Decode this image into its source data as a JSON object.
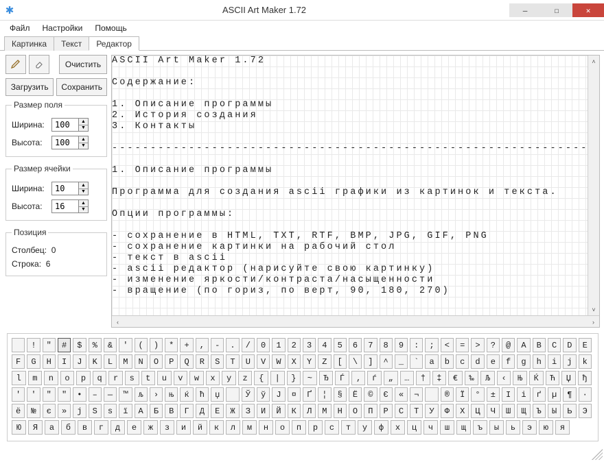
{
  "window": {
    "title": "ASCII Art Maker 1.72"
  },
  "menu": {
    "file": "Файл",
    "settings": "Настройки",
    "help": "Помощь"
  },
  "tabs": {
    "picture": "Картинка",
    "text": "Текст",
    "editor": "Редактор"
  },
  "tools": {
    "pencil_icon": "pencil-icon",
    "eraser_icon": "eraser-icon",
    "clear": "Очистить",
    "load": "Загрузить",
    "save": "Сохранить"
  },
  "field_size": {
    "legend": "Размер поля",
    "width_label": "Ширина:",
    "width_value": "100",
    "height_label": "Высота:",
    "height_value": "100"
  },
  "cell_size": {
    "legend": "Размер ячейки",
    "width_label": "Ширина:",
    "width_value": "10",
    "height_label": "Высота:",
    "height_value": "16"
  },
  "position": {
    "legend": "Позиция",
    "col_label": "Столбец:",
    "col_value": "0",
    "row_label": "Строка:",
    "row_value": "6"
  },
  "editor_text": "ASCII Art Maker 1.72\n\nСодержание:\n\n1. Описание программы\n2. История создания\n3. Контакты\n\n------------------------------------------------------------------\n\n1. Описание программы\n\nПрограмма для создания ascii графики из картинок и текста.\n\nОпции программы:\n\n- сохранение в HTML, TXT, RTF, BMP, JPG, GIF, PNG\n- сохранение картинки на рабочий стол\n- текст в ascii\n- ascii редактор (нарисуйте свою картинку)\n- изменение яркости/контраста/насыщенности\n- вращение (по гориз, по верт, 90, 180, 270)",
  "palette": [
    [
      " ",
      "!",
      "\"",
      "#",
      "$",
      "%",
      "&",
      "'",
      "(",
      ")",
      "*",
      "+",
      ",",
      "-",
      ".",
      "/",
      "0",
      "1",
      "2",
      "3",
      "4",
      "5",
      "6",
      "7",
      "8",
      "9",
      ":",
      ";",
      "<",
      "=",
      ">",
      "?",
      "@",
      "A",
      "B",
      "C",
      "D",
      "E"
    ],
    [
      "F",
      "G",
      "H",
      "I",
      "J",
      "K",
      "L",
      "M",
      "N",
      "O",
      "P",
      "Q",
      "R",
      "S",
      "T",
      "U",
      "V",
      "W",
      "X",
      "Y",
      "Z",
      "[",
      "\\",
      "]",
      "^",
      "_",
      "`",
      "a",
      "b",
      "c",
      "d",
      "e",
      "f",
      "g",
      "h",
      "i",
      "j",
      "k"
    ],
    [
      "l",
      "m",
      "n",
      "o",
      "p",
      "q",
      "r",
      "s",
      "t",
      "u",
      "v",
      "w",
      "x",
      "y",
      "z",
      "{",
      "|",
      "}",
      "~",
      "Ђ",
      "Ѓ",
      "‚",
      "ѓ",
      "„",
      "…",
      "†",
      "‡",
      "€",
      "‰",
      "Љ",
      "‹",
      "Њ",
      "Ќ",
      "Ћ",
      "Џ",
      "ђ"
    ],
    [
      "'",
      "'",
      "\"",
      "\"",
      "•",
      "–",
      "—",
      "™",
      "љ",
      "›",
      "њ",
      "ќ",
      "ћ",
      "џ",
      " ",
      "Ў",
      "ў",
      "Ј",
      "¤",
      "Ґ",
      "¦",
      "§",
      "Ё",
      "©",
      "Є",
      "«",
      "¬",
      "­",
      "®",
      "Ї",
      "°",
      "±",
      "І",
      "і",
      "ґ",
      "µ",
      "¶",
      "·"
    ],
    [
      "ё",
      "№",
      "є",
      "»",
      "ј",
      "Ѕ",
      "ѕ",
      "ї",
      "А",
      "Б",
      "В",
      "Г",
      "Д",
      "Е",
      "Ж",
      "З",
      "И",
      "Й",
      "К",
      "Л",
      "М",
      "Н",
      "О",
      "П",
      "Р",
      "С",
      "Т",
      "У",
      "Ф",
      "Х",
      "Ц",
      "Ч",
      "Ш",
      "Щ",
      "Ъ",
      "Ы",
      "Ь",
      "Э"
    ],
    [
      "Ю",
      "Я",
      "а",
      "б",
      "в",
      "г",
      "д",
      "е",
      "ж",
      "з",
      "и",
      "й",
      "к",
      "л",
      "м",
      "н",
      "о",
      "п",
      "р",
      "с",
      "т",
      "у",
      "ф",
      "х",
      "ц",
      "ч",
      "ш",
      "щ",
      "ъ",
      "ы",
      "ь",
      "э",
      "ю",
      "я"
    ]
  ],
  "selected_key": "#"
}
